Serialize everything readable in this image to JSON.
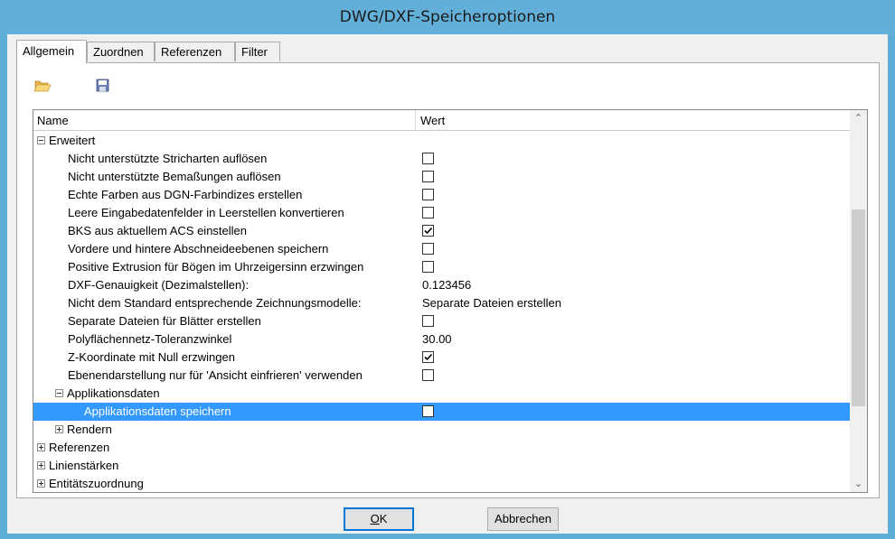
{
  "window": {
    "title": "DWG/DXF-Speicheroptionen"
  },
  "tabs": [
    {
      "label": "Allgemein",
      "active": true
    },
    {
      "label": "Zuordnen",
      "active": false
    },
    {
      "label": "Referenzen",
      "active": false
    },
    {
      "label": "Filter",
      "active": false
    }
  ],
  "toolbar": {
    "open_icon": "folder-open-icon",
    "save_icon": "floppy-disk-icon"
  },
  "grid": {
    "col_name": "Name",
    "col_value": "Wert",
    "rows": [
      {
        "label": "Erweitert",
        "expander": "minus",
        "level": 0
      },
      {
        "label": "Nicht unterstützte Stricharten auflösen",
        "checked": false,
        "level": 1
      },
      {
        "label": "Nicht unterstützte Bemaßungen auflösen",
        "checked": false,
        "level": 1
      },
      {
        "label": "Echte Farben aus DGN-Farbindizes erstellen",
        "checked": false,
        "level": 1
      },
      {
        "label": "Leere Eingabedatenfelder in Leerstellen konvertieren",
        "checked": false,
        "level": 1
      },
      {
        "label": "BKS aus aktuellem ACS einstellen",
        "checked": true,
        "level": 1
      },
      {
        "label": "Vordere und hintere Abschneideebenen speichern",
        "checked": false,
        "level": 1
      },
      {
        "label": "Positive Extrusion für Bögen im Uhrzeigersinn erzwingen",
        "checked": false,
        "level": 1
      },
      {
        "label": "DXF-Genauigkeit (Dezimalstellen):",
        "value": "0.123456",
        "level": 1
      },
      {
        "label": "Nicht dem Standard entsprechende Zeichnungsmodelle:",
        "value": "Separate Dateien erstellen",
        "level": 1
      },
      {
        "label": "Separate Dateien für Blätter erstellen",
        "checked": false,
        "level": 1
      },
      {
        "label": "Polyflächennetz-Toleranzwinkel",
        "value": "30.00",
        "level": 1
      },
      {
        "label": "Z-Koordinate mit Null erzwingen",
        "checked": true,
        "level": 1
      },
      {
        "label": "Ebenendarstellung nur für 'Ansicht einfrieren' verwenden",
        "checked": false,
        "level": 1
      },
      {
        "label": "Applikationsdaten",
        "expander": "minus",
        "level": 1
      },
      {
        "label": "Applikationsdaten speichern",
        "checked": false,
        "level": 2,
        "selected": true
      },
      {
        "label": "Rendern",
        "expander": "plus",
        "level": 1
      },
      {
        "label": "Referenzen",
        "expander": "plus",
        "level": 0
      },
      {
        "label": "Linienstärken",
        "expander": "plus",
        "level": 0
      },
      {
        "label": "Entitätszuordnung",
        "expander": "plus",
        "level": 0
      }
    ]
  },
  "buttons": {
    "ok_prefix": "",
    "ok_underlined": "O",
    "ok_rest": "K",
    "cancel": "Abbrechen"
  },
  "colors": {
    "selection": "#3399ff",
    "titlebar": "#62b0d9"
  }
}
